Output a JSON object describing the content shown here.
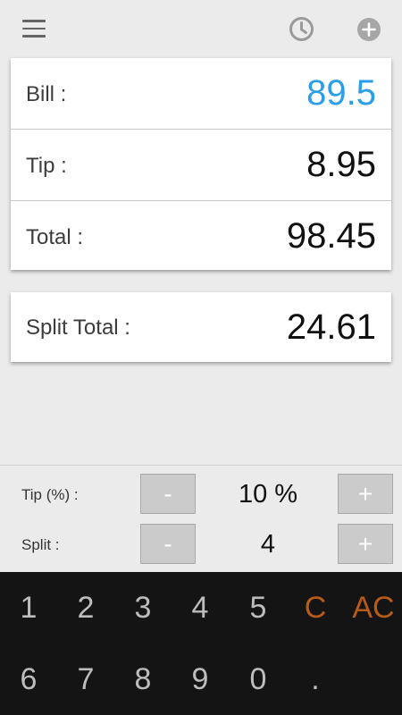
{
  "icons": {
    "menu": "menu-icon",
    "history": "clock-icon",
    "add": "plus-circle-icon"
  },
  "colors": {
    "accent_blue": "#2a9ee8",
    "clear_orange": "#b85a18",
    "keypad_bg": "#141414"
  },
  "summary": {
    "bill_label": "Bill :",
    "bill_value": "89.5",
    "tip_label": "Tip :",
    "tip_value": "8.95",
    "total_label": "Total :",
    "total_value": "98.45"
  },
  "split_card": {
    "label": "Split Total :",
    "value": "24.61"
  },
  "controls": {
    "tip_label": "Tip (%) :",
    "tip_value": "10 %",
    "split_label": "Split :",
    "split_value": "4",
    "minus": "-",
    "plus": "+"
  },
  "keypad": {
    "row1": [
      "1",
      "2",
      "3",
      "4",
      "5",
      "C",
      "AC"
    ],
    "row2": [
      "6",
      "7",
      "8",
      "9",
      "0",
      "."
    ]
  }
}
